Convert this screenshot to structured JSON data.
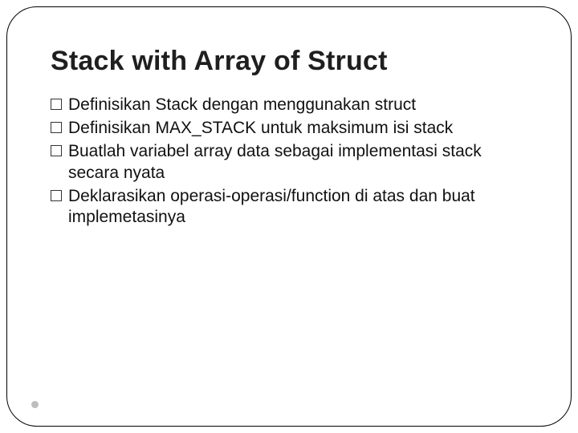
{
  "slide": {
    "title": "Stack with Array of Struct",
    "bullets": [
      "Definisikan Stack dengan menggunakan struct",
      "Definisikan MAX_STACK untuk maksimum isi stack",
      "Buatlah variabel array data sebagai implementasi stack secara nyata",
      "Deklarasikan operasi-operasi/function di atas dan buat implemetasinya"
    ]
  }
}
